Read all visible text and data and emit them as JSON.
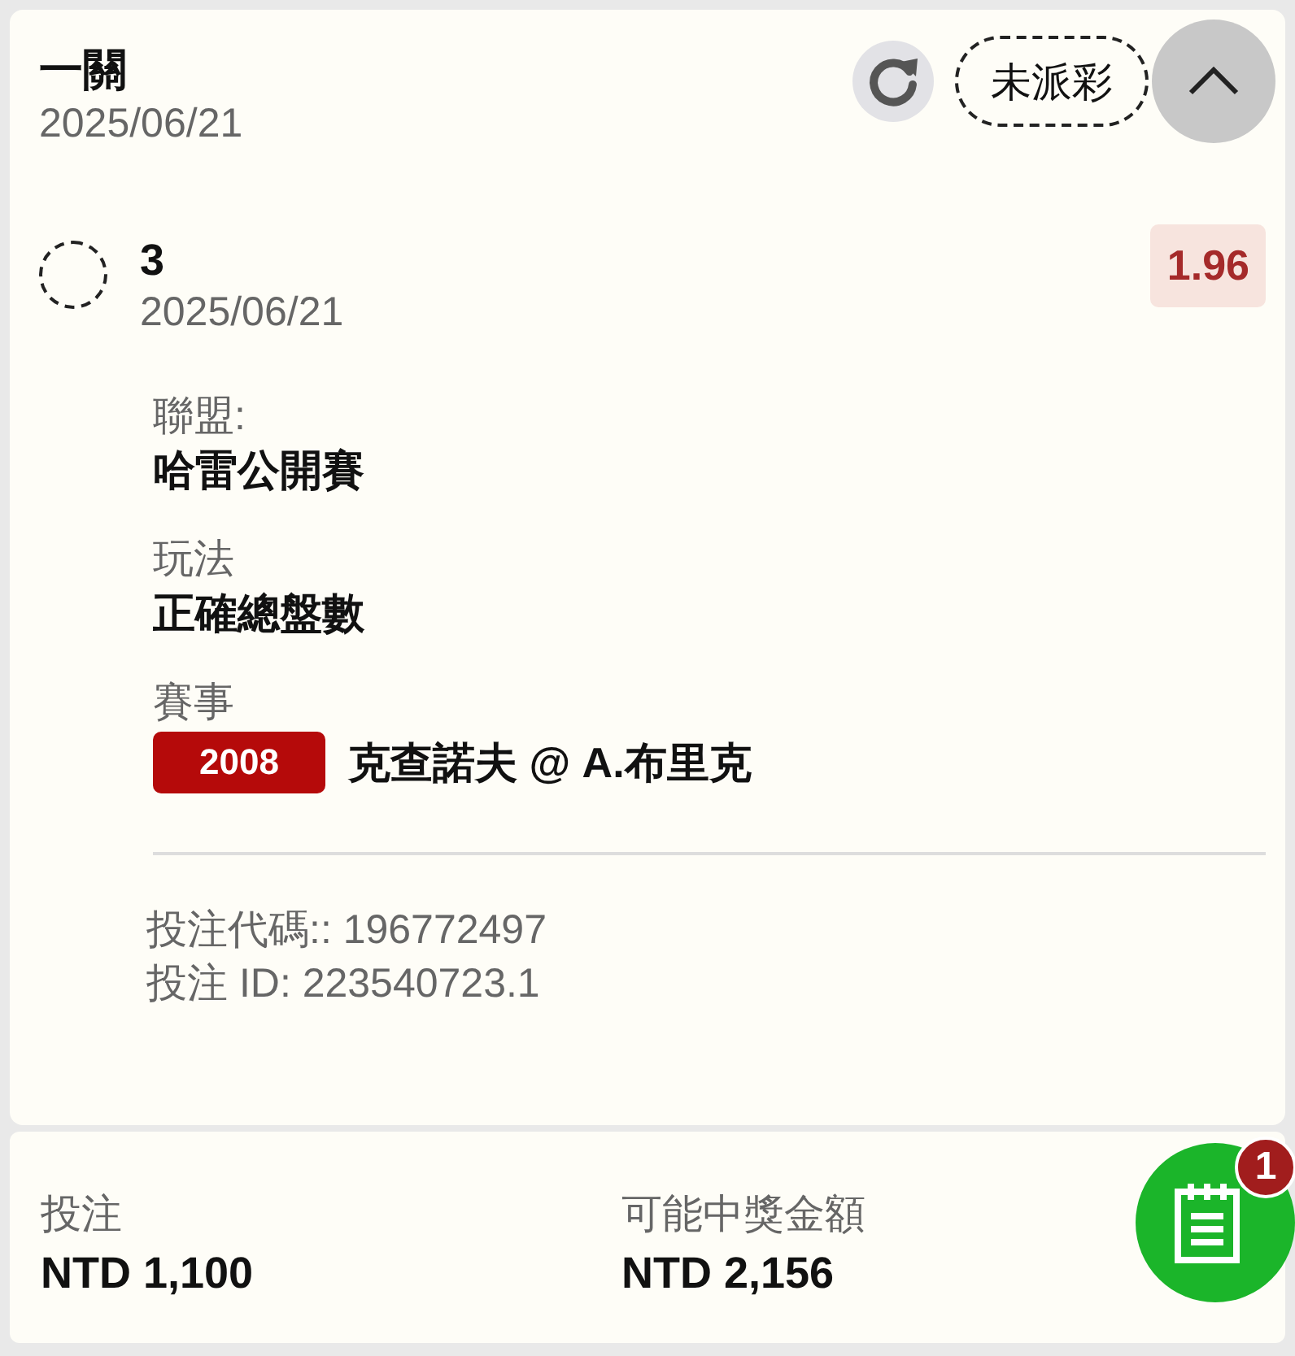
{
  "header": {
    "title": "一關",
    "date": "2025/06/21",
    "status": "未派彩",
    "expanded": true
  },
  "selection": {
    "selected": false,
    "name": "3",
    "date": "2025/06/21",
    "odds": "1.96"
  },
  "fields": [
    {
      "label": "聯盟:",
      "value": "哈雷公開賽"
    },
    {
      "label": "玩法",
      "value": "正確總盤數"
    }
  ],
  "event": {
    "label": "賽事",
    "code": "2008",
    "teams": "克查諾夫 @ A.布里克"
  },
  "bet_code": "投注代碼:: 196772497",
  "bet_id": "投注 ID: 223540723.1",
  "footer": {
    "stake_label": "投注",
    "stake": "NTD 1,100",
    "payout_label": "可能中獎金額",
    "payout": "NTD 2,156"
  },
  "fab": {
    "badge": "1"
  }
}
